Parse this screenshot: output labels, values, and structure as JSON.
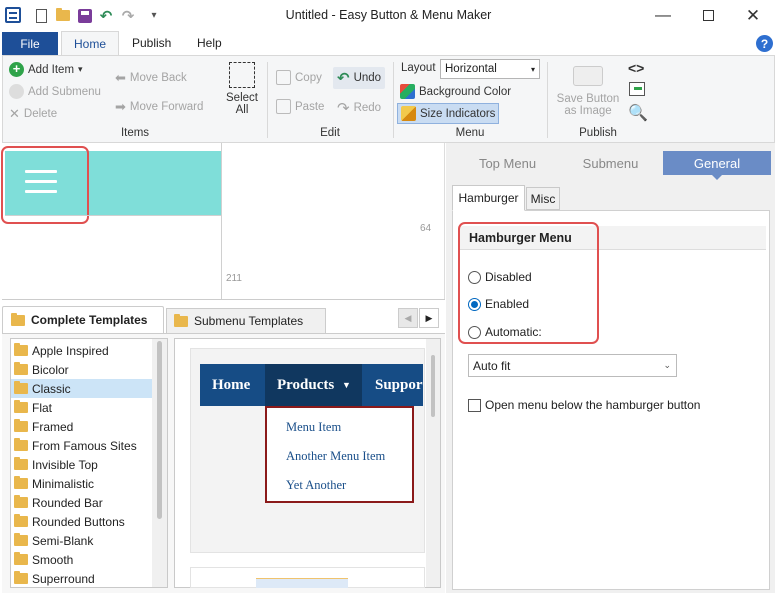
{
  "window": {
    "title": "Untitled - Easy Button & Menu Maker",
    "controls": [
      "minimize-icon",
      "maximize-icon",
      "close-icon"
    ]
  },
  "ribbon_tabs": {
    "file": "File",
    "home": "Home",
    "publish": "Publish",
    "help": "Help"
  },
  "ribbon": {
    "items": {
      "group": "Items",
      "add_item": "Add Item",
      "add_submenu": "Add Submenu",
      "delete": "Delete",
      "move_back": "Move Back",
      "move_forward": "Move Forward",
      "select_all_1": "Select",
      "select_all_2": "All"
    },
    "edit": {
      "group": "Edit",
      "copy": "Copy",
      "paste": "Paste",
      "undo": "Undo",
      "redo": "Redo"
    },
    "menu": {
      "group": "Menu",
      "layout_label": "Layout",
      "layout_value": "Horizontal",
      "background_color": "Background Color",
      "size_indicators": "Size Indicators"
    },
    "publish": {
      "group": "Publish",
      "save_button_1": "Save Button",
      "save_button_2": "as Image"
    }
  },
  "canvas": {
    "size_w": "64",
    "size_h": "211"
  },
  "templates": {
    "tabs": [
      "Complete Templates",
      "Submenu Templates"
    ],
    "list": [
      "Apple Inspired",
      "Bicolor",
      "Classic",
      "Flat",
      "Framed",
      "From Famous Sites",
      "Invisible Top",
      "Minimalistic",
      "Rounded Bar",
      "Rounded Buttons",
      "Semi-Blank",
      "Smooth",
      "Superround"
    ],
    "selected": "Classic",
    "preview": {
      "menu": [
        "Home",
        "Products",
        "Suppor"
      ],
      "submenu": [
        "Menu Item",
        "Another Menu Item",
        "Yet Another"
      ]
    }
  },
  "props": {
    "tabs": [
      "Top Menu",
      "Submenu",
      "General"
    ],
    "active_tab": "General",
    "subtabs": [
      "Hamburger",
      "Misc"
    ],
    "section_title": "Hamburger Menu",
    "options": [
      "Disabled",
      "Enabled",
      "Automatic:"
    ],
    "selected_option": "Enabled",
    "auto_select": "Auto fit",
    "checkbox_label": "Open menu below the hamburger button",
    "checkbox_checked": false
  },
  "colors": {
    "accent": "#1e4f98",
    "hamburger_bg": "#7fded9",
    "active_tab": "#6a8cc6",
    "highlight": "#e05050",
    "preview_bar": "#164c85",
    "submenu_border": "#8b1a1a"
  }
}
